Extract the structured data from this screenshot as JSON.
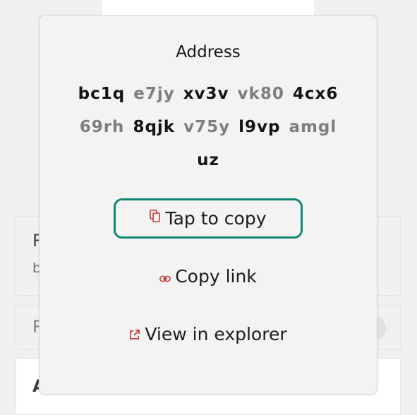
{
  "background": {
    "card1_letter": "R",
    "card1_sub_letter": "b",
    "card2_letter": "R",
    "card3_letter": "A"
  },
  "popover": {
    "title": "Address",
    "address_lines": [
      [
        {
          "text": "bc1q",
          "tone": "dark"
        },
        {
          "text": "e7jy",
          "tone": "grey"
        },
        {
          "text": "xv3v",
          "tone": "dark"
        },
        {
          "text": "vk80",
          "tone": "grey"
        },
        {
          "text": "4cx6",
          "tone": "dark"
        }
      ],
      [
        {
          "text": "69rh",
          "tone": "grey"
        },
        {
          "text": "8qjk",
          "tone": "dark"
        },
        {
          "text": "v75y",
          "tone": "grey"
        },
        {
          "text": "l9vp",
          "tone": "dark"
        },
        {
          "text": "amgl",
          "tone": "grey"
        }
      ],
      [
        {
          "text": "uz",
          "tone": "dark"
        }
      ]
    ],
    "actions": {
      "copy_label": "Tap to copy",
      "copy_icon": "copy-icon",
      "copy_link_label": "Copy link",
      "copy_link_icon": "link-icon",
      "explorer_label": "View in explorer",
      "explorer_icon": "external-link-icon"
    }
  },
  "colors": {
    "accent_border": "#0f8770",
    "icon_red": "#c9353d",
    "address_dark": "#141414",
    "address_grey": "#7c7e82"
  }
}
